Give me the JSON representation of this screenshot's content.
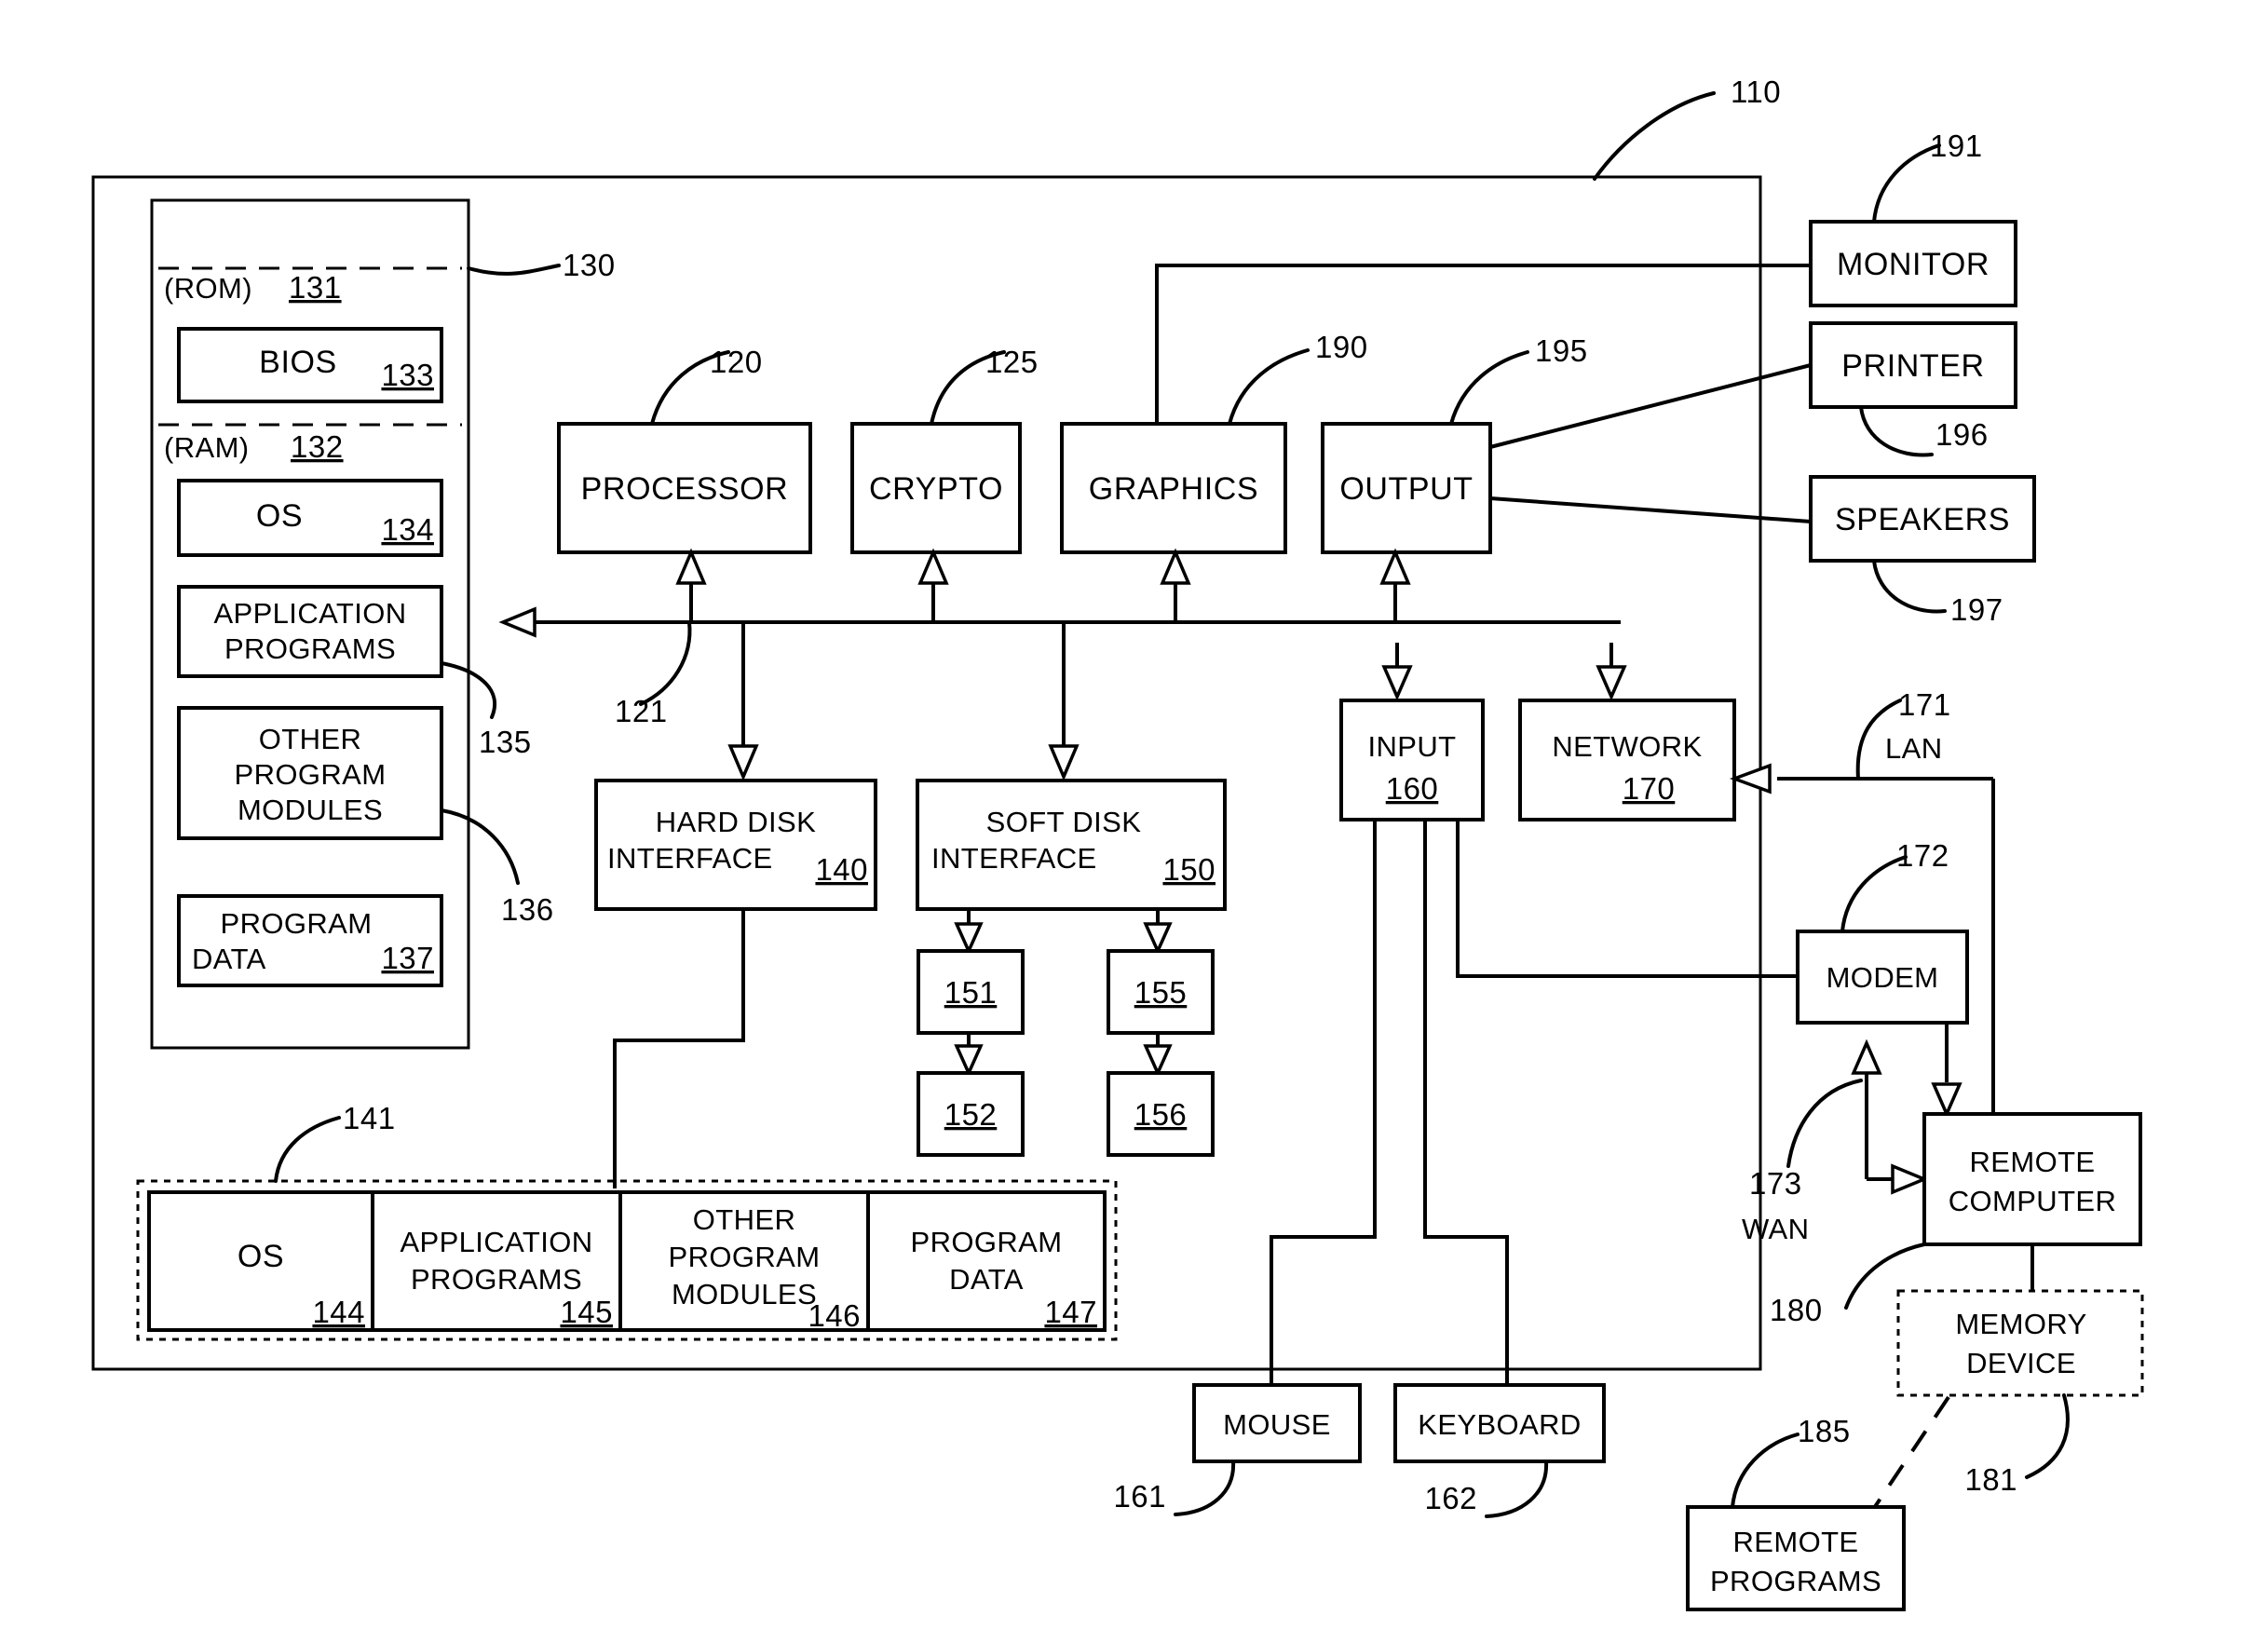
{
  "figure": {
    "system_ref": "110",
    "system_memory_ref": "130",
    "bus_ref": "121"
  },
  "memory": {
    "rom_label": "(ROM)",
    "rom_ref": "131",
    "ram_label": "(RAM)",
    "ram_ref": "132",
    "blocks": [
      {
        "label": "BIOS",
        "ref": "133"
      },
      {
        "label": "OS",
        "ref": "134"
      },
      {
        "label_line1": "APPLICATION",
        "label_line2": "PROGRAMS",
        "ref": "135"
      },
      {
        "label_line1": "OTHER",
        "label_line2": "PROGRAM",
        "label_line3": "MODULES",
        "ref": "136"
      },
      {
        "label_line1": "PROGRAM",
        "label_line2": "DATA",
        "ref": "137"
      }
    ]
  },
  "core": [
    {
      "label": "PROCESSOR",
      "ref": "120"
    },
    {
      "label": "CRYPTO",
      "ref": "125"
    },
    {
      "label": "GRAPHICS",
      "ref": "190"
    },
    {
      "label": "OUTPUT",
      "ref": "195"
    }
  ],
  "peripherals": [
    {
      "label": "MONITOR",
      "ref": "191"
    },
    {
      "label": "PRINTER",
      "ref": "196"
    },
    {
      "label": "SPEAKERS",
      "ref": "197"
    }
  ],
  "interfaces": [
    {
      "label_line1": "HARD DISK",
      "label_line2": "INTERFACE",
      "ref": "140"
    },
    {
      "label_line1": "SOFT DISK",
      "label_line2": "INTERFACE",
      "ref": "150"
    }
  ],
  "drives": [
    {
      "ref": "151"
    },
    {
      "ref": "152"
    },
    {
      "ref": "155"
    },
    {
      "ref": "156"
    }
  ],
  "io": [
    {
      "label": "INPUT",
      "ref": "160"
    },
    {
      "label": "NETWORK",
      "ref": "170"
    }
  ],
  "input_devices": [
    {
      "label": "MOUSE",
      "ref": "161"
    },
    {
      "label": "KEYBOARD",
      "ref": "162"
    }
  ],
  "storage_strip": {
    "ref": "141",
    "cells": [
      {
        "label_line1": "OS",
        "label_line2": "",
        "ref": "144"
      },
      {
        "label_line1": "APPLICATION",
        "label_line2": "PROGRAMS",
        "ref": "145"
      },
      {
        "label_line1": "OTHER",
        "label_line2": "PROGRAM",
        "label_line3": "MODULES",
        "ref": "146"
      },
      {
        "label_line1": "PROGRAM",
        "label_line2": "DATA",
        "ref": "147"
      }
    ]
  },
  "network": {
    "lan_ref": "171",
    "lan_label": "LAN",
    "modem_label": "MODEM",
    "modem_ref": "172",
    "wan_ref": "173",
    "wan_label": "WAN",
    "remote_computer_line1": "REMOTE",
    "remote_computer_line2": "COMPUTER",
    "remote_computer_ref": "180",
    "memory_device_line1": "MEMORY",
    "memory_device_line2": "DEVICE",
    "memory_device_ref": "181",
    "remote_programs_line1": "REMOTE",
    "remote_programs_line2": "PROGRAMS",
    "remote_programs_ref": "185"
  }
}
